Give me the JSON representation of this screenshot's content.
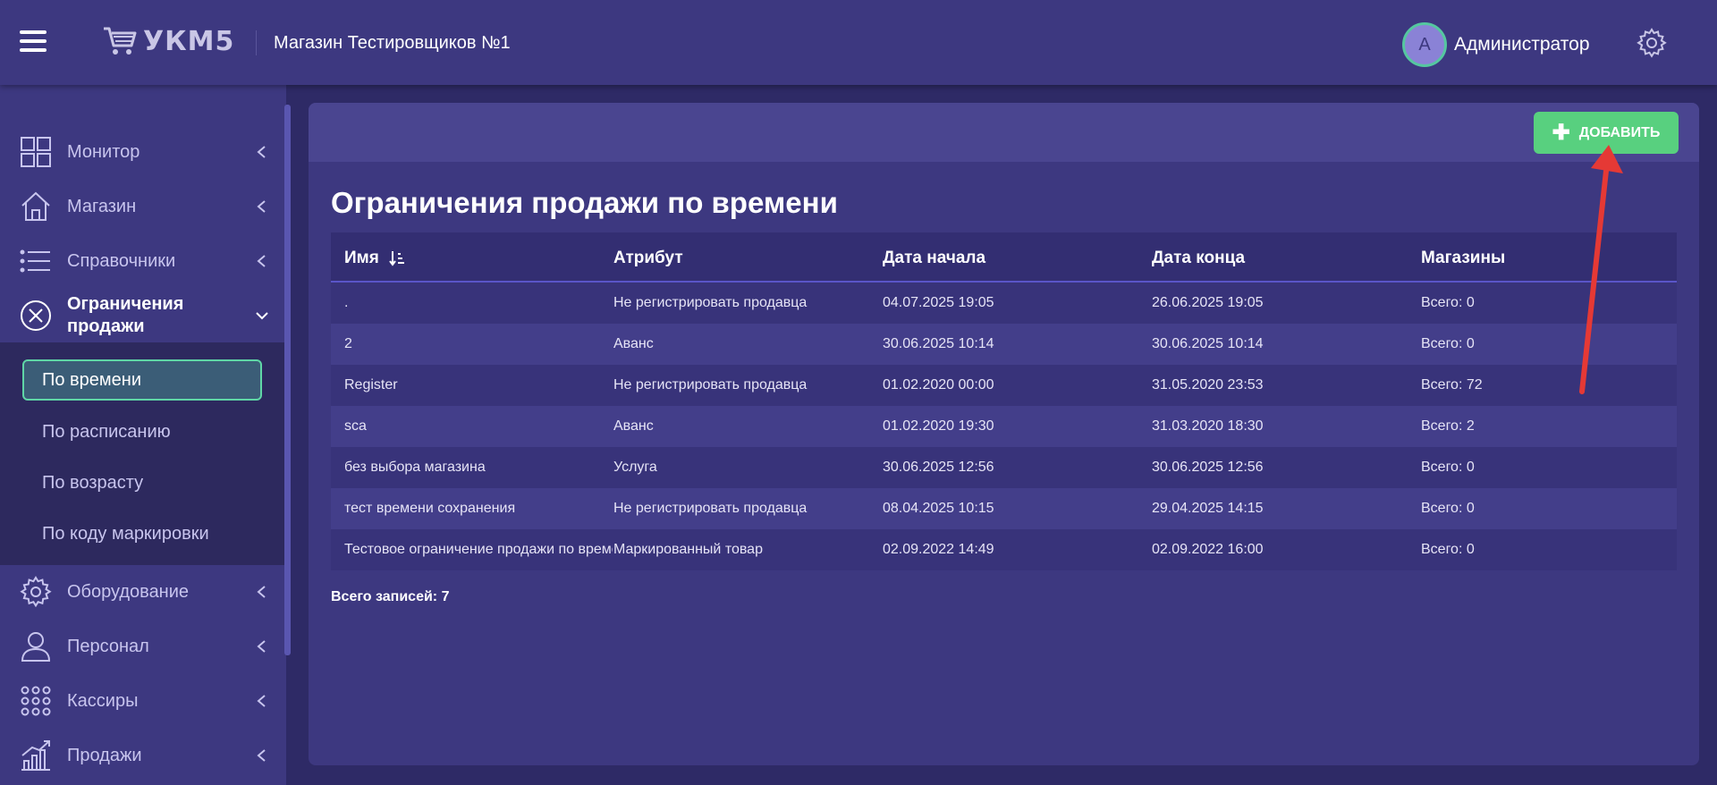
{
  "header": {
    "logo_text": "УКМ5",
    "shop_name": "Магазин Тестировщиков №1",
    "avatar_letter": "A",
    "user_name": "Администратор"
  },
  "sidebar": {
    "items": [
      {
        "label": "Монитор",
        "icon": "grid-icon"
      },
      {
        "label": "Магазин",
        "icon": "home-icon"
      },
      {
        "label": "Справочники",
        "icon": "list-icon"
      },
      {
        "label": "Ограничения продажи",
        "icon": "circle-x-icon"
      },
      {
        "label": "Оборудование",
        "icon": "gear-icon"
      },
      {
        "label": "Персонал",
        "icon": "user-icon"
      },
      {
        "label": "Кассиры",
        "icon": "dots-grid-icon"
      },
      {
        "label": "Продажи",
        "icon": "chart-icon"
      }
    ],
    "submenu": [
      "По времени",
      "По расписанию",
      "По возрасту",
      "По коду маркировки"
    ]
  },
  "toolbar": {
    "add_label": "ДОБАВИТЬ"
  },
  "page": {
    "title": "Ограничения продажи по времени"
  },
  "table": {
    "columns": [
      "Имя",
      "Атрибут",
      "Дата начала",
      "Дата конца",
      "Магазины"
    ],
    "rows": [
      [
        ".",
        "Не регистрировать продавца",
        "04.07.2025 19:05",
        "26.06.2025 19:05",
        "Всего: 0"
      ],
      [
        "2",
        "Аванс",
        "30.06.2025 10:14",
        "30.06.2025 10:14",
        "Всего: 0"
      ],
      [
        "Register",
        "Не регистрировать продавца",
        "01.02.2020 00:00",
        "31.05.2020 23:53",
        "Всего: 72"
      ],
      [
        "sca",
        "Аванс",
        "01.02.2020 19:30",
        "31.03.2020 18:30",
        "Всего: 2"
      ],
      [
        "без выбора магазина",
        "Услуга",
        "30.06.2025 12:56",
        "30.06.2025 12:56",
        "Всего: 0"
      ],
      [
        "тест времени сохранения",
        "Не регистрировать продавца",
        "08.04.2025 10:15",
        "29.04.2025 14:15",
        "Всего: 0"
      ],
      [
        "Тестовое ограничение продажи по времени",
        "Маркированный товар",
        "02.09.2022 14:49",
        "02.09.2022 16:00",
        "Всего: 0"
      ]
    ]
  },
  "footer": {
    "total": "Всего записей: 7"
  },
  "colors": {
    "header_bg": "#3d3880",
    "page_bg": "#2e2a66",
    "accent_green": "#58d07f",
    "active_border": "#5fd6a6",
    "annotation_arrow": "#e53935"
  }
}
